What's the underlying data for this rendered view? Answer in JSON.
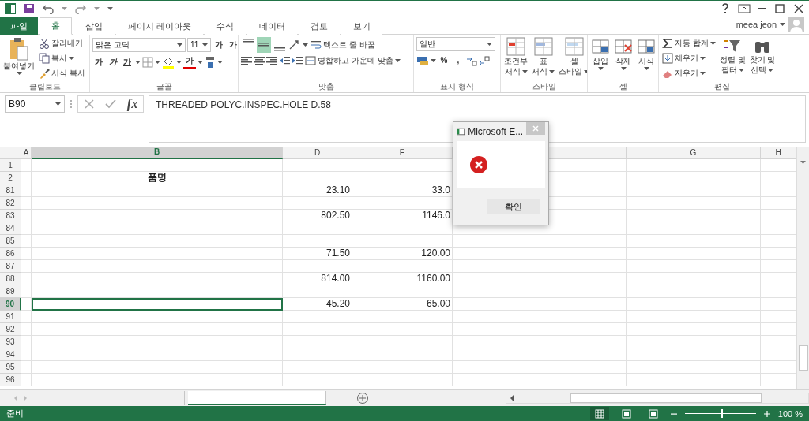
{
  "user": {
    "name": "meea jeon"
  },
  "tabs": [
    {
      "label": "파일",
      "kind": "file",
      "selected": false
    },
    {
      "label": "홈",
      "kind": "tab",
      "selected": true
    },
    {
      "label": "삽입",
      "kind": "tab",
      "selected": false
    },
    {
      "label": "페이지 레이아웃",
      "kind": "tab",
      "selected": false
    },
    {
      "label": "수식",
      "kind": "tab",
      "selected": false
    },
    {
      "label": "데이터",
      "kind": "tab",
      "selected": false
    },
    {
      "label": "검토",
      "kind": "tab",
      "selected": false
    },
    {
      "label": "보기",
      "kind": "tab",
      "selected": false
    }
  ],
  "ribbon": {
    "clipboard": {
      "label": "클립보드",
      "paste": "붙여넣기",
      "cut": "잘라내기",
      "copy": "복사",
      "format_painter": "서식 복사"
    },
    "font": {
      "label": "글꼴",
      "font_name": "맑은 고딕",
      "font_size": "11",
      "grow": "가",
      "shrink": "가",
      "bold": "가",
      "italic": "가",
      "underline": "가",
      "font_color": "가"
    },
    "alignment": {
      "label": "맞춤",
      "vertical_align": [
        {
          "selected": false
        },
        {
          "selected": true
        },
        {
          "selected": false
        }
      ],
      "wrap_text": "텍스트 줄 바꿈",
      "merge_center": "병합하고 가운데 맞춤"
    },
    "number": {
      "label": "표시 형식",
      "format": "일반",
      "percent": "%",
      "comma": ","
    },
    "styles": {
      "label": "스타일",
      "items": [
        {
          "lines": [
            "조건부",
            "서식"
          ]
        },
        {
          "lines": [
            "표",
            "서식"
          ]
        },
        {
          "lines": [
            "셀",
            "스타일"
          ]
        }
      ]
    },
    "cells": {
      "label": "셀",
      "items": [
        "삽입",
        "삭제",
        "서식"
      ]
    },
    "editing": {
      "label": "편집",
      "autosum": "자동 합계",
      "fill": "채우기",
      "clear": "지우기",
      "sort": [
        "정렬 및",
        "필터"
      ],
      "find": [
        "찾기 및",
        "선택"
      ]
    }
  },
  "formula_bar": {
    "name_box": "B90",
    "function_label": "fx",
    "formula": "THREADED POLYC.INSPEC.HOLE D.58"
  },
  "columns": [
    {
      "label": "A",
      "selected": false
    },
    {
      "label": "B",
      "selected": true
    },
    {
      "label": "D",
      "selected": false
    },
    {
      "label": "E",
      "selected": false
    },
    {
      "selected": false
    },
    {
      "label": "G",
      "selected": false
    },
    {
      "label": "H",
      "selected": false
    }
  ],
  "rows": [
    {
      "header": "1",
      "kind": "data",
      "selected": false
    },
    {
      "header": "2",
      "kind": "heading",
      "selected": false,
      "col_b": "품명"
    },
    {
      "header": "81",
      "kind": "data",
      "selected": false,
      "col_d": "23.10",
      "col_e": "33.0"
    },
    {
      "header": "82",
      "kind": "data",
      "selected": false
    },
    {
      "header": "83",
      "kind": "data",
      "selected": false,
      "col_d": "802.50",
      "col_e": "1146.0"
    },
    {
      "header": "84",
      "kind": "data",
      "selected": false
    },
    {
      "header": "85",
      "kind": "data",
      "selected": false
    },
    {
      "header": "86",
      "kind": "data",
      "selected": false,
      "col_d": "71.50",
      "col_e": "120.00"
    },
    {
      "header": "87",
      "kind": "data",
      "selected": false
    },
    {
      "header": "88",
      "kind": "data",
      "selected": false,
      "col_d": "814.00",
      "col_e": "1160.00"
    },
    {
      "header": "89",
      "kind": "data",
      "selected": false
    },
    {
      "header": "90",
      "kind": "data",
      "selected": true,
      "col_d": "45.20",
      "col_e": "65.00"
    },
    {
      "header": "91",
      "kind": "data",
      "selected": false
    },
    {
      "header": "92",
      "kind": "data",
      "selected": false
    },
    {
      "header": "93",
      "kind": "data",
      "selected": false
    },
    {
      "header": "94",
      "kind": "data",
      "selected": false
    },
    {
      "header": "95",
      "kind": "data",
      "selected": false
    },
    {
      "header": "96",
      "kind": "data",
      "selected": false
    }
  ],
  "sheet_tabs": [
    {
      "selected": false
    },
    {
      "selected": true
    }
  ],
  "status_bar": {
    "status": "준비",
    "views": [
      {
        "selected": true
      },
      {
        "selected": false
      },
      {
        "selected": false
      }
    ],
    "level": 0.5,
    "zoom": "100 %"
  },
  "dialog": {
    "title": "Microsoft E...",
    "button": "확인"
  }
}
